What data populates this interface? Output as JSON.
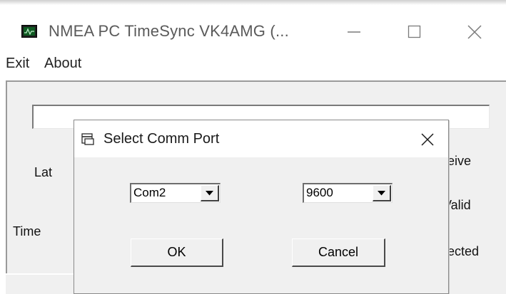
{
  "window": {
    "title": "NMEA PC TimeSync   VK4AMG (...",
    "icon": "monitor-icon",
    "controls": [
      "minimize-icon",
      "maximize-icon",
      "close-icon"
    ]
  },
  "menu": {
    "exit": "Exit",
    "about": "About"
  },
  "background_labels": {
    "lat": "Lat",
    "time": "Time",
    "receive": "eive",
    "valid": "Valid",
    "selected": "ected"
  },
  "nmea_field": {
    "value": ""
  },
  "dialog": {
    "title": "Select Comm Port",
    "icon": "window-icon",
    "port": {
      "selected": "Com2"
    },
    "baud": {
      "selected": "9600"
    },
    "ok_label": "OK",
    "cancel_label": "Cancel"
  },
  "colors": {
    "client_bg": "#f0f0f0",
    "title_text": "#5a5a5a",
    "icon_screen": "#0f5a22"
  }
}
